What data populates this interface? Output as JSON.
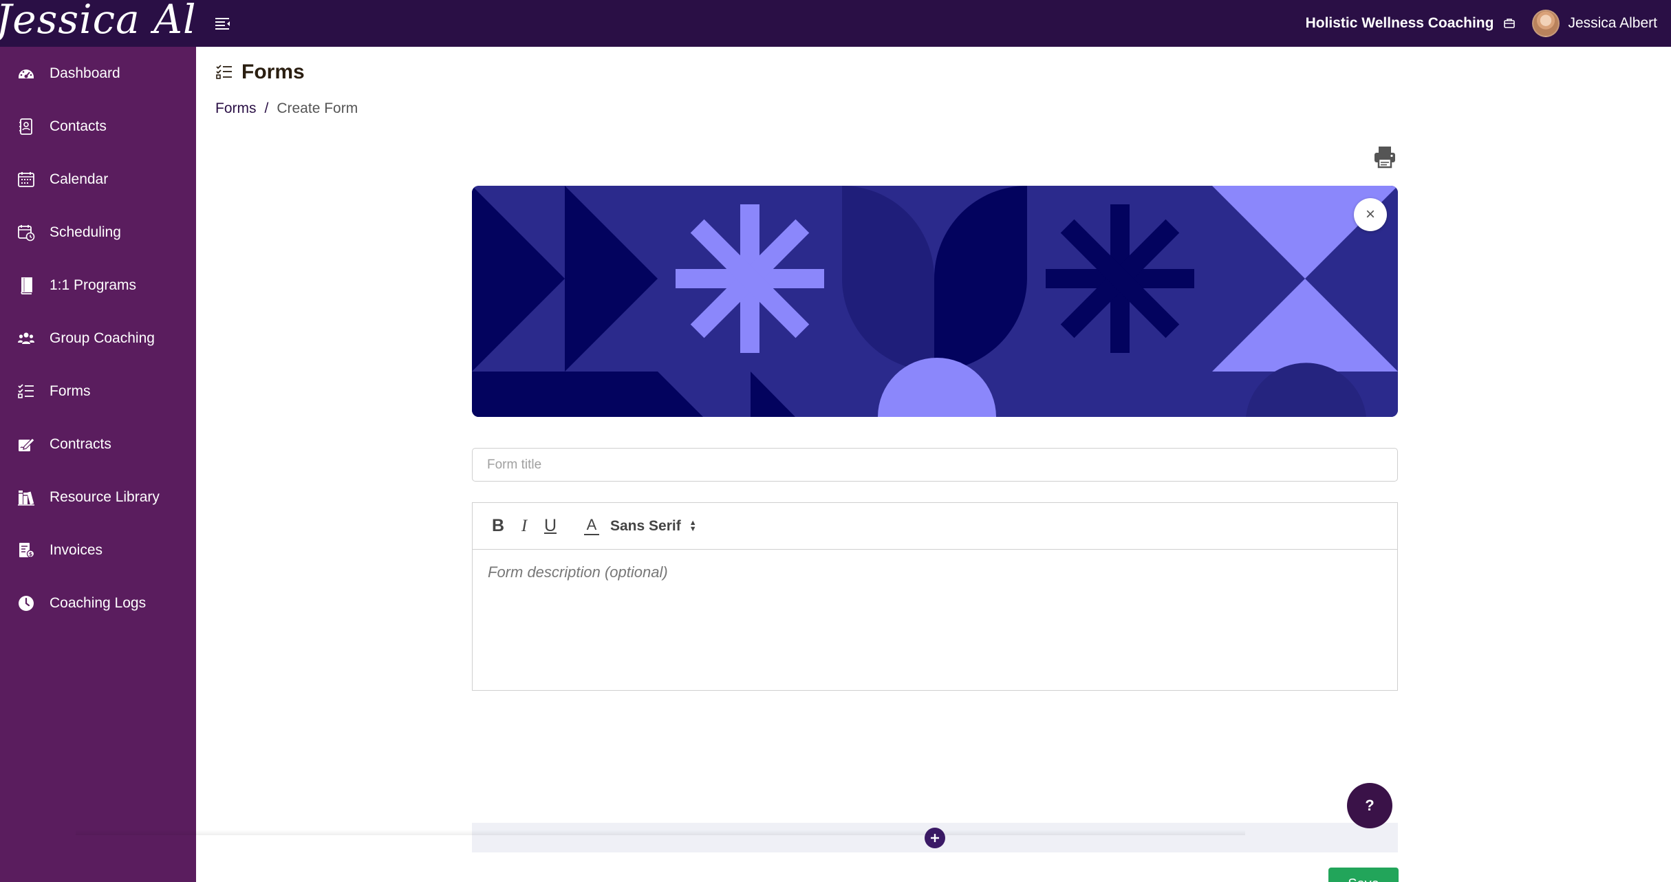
{
  "brand": {
    "logo_text": "Jessica Albert"
  },
  "topbar": {
    "business_name": "Holistic Wellness Coaching",
    "user_name": "Jessica Albert"
  },
  "sidebar": {
    "items": [
      {
        "label": "Dashboard",
        "icon": "dashboard-icon"
      },
      {
        "label": "Contacts",
        "icon": "contacts-icon"
      },
      {
        "label": "Calendar",
        "icon": "calendar-icon"
      },
      {
        "label": "Scheduling",
        "icon": "scheduling-icon"
      },
      {
        "label": "1:1 Programs",
        "icon": "book-icon"
      },
      {
        "label": "Group Coaching",
        "icon": "group-icon"
      },
      {
        "label": "Forms",
        "icon": "forms-icon"
      },
      {
        "label": "Contracts",
        "icon": "contract-icon"
      },
      {
        "label": "Resource Library",
        "icon": "library-icon"
      },
      {
        "label": "Invoices",
        "icon": "invoice-icon"
      },
      {
        "label": "Coaching Logs",
        "icon": "clock-icon"
      }
    ]
  },
  "page": {
    "title": "Forms",
    "breadcrumb": {
      "parent": "Forms",
      "separator": "/",
      "current": "Create Form"
    }
  },
  "form": {
    "title_placeholder": "Form title",
    "title_value": "",
    "description_placeholder": "Form description (optional)",
    "font": "Sans Serif",
    "toolbar": {
      "bold": "B",
      "italic": "I",
      "underline": "U",
      "text_color": "A"
    }
  },
  "actions": {
    "save_label": "Save",
    "help_label": "?",
    "close_symbol": "×"
  },
  "colors": {
    "topbar": "#2a0f45",
    "sidebar": "#5a1d5e",
    "save": "#22a55a",
    "banner_dark": "#03035e",
    "banner_mid": "#2b2a8c",
    "banner_light": "#8b87fb"
  }
}
